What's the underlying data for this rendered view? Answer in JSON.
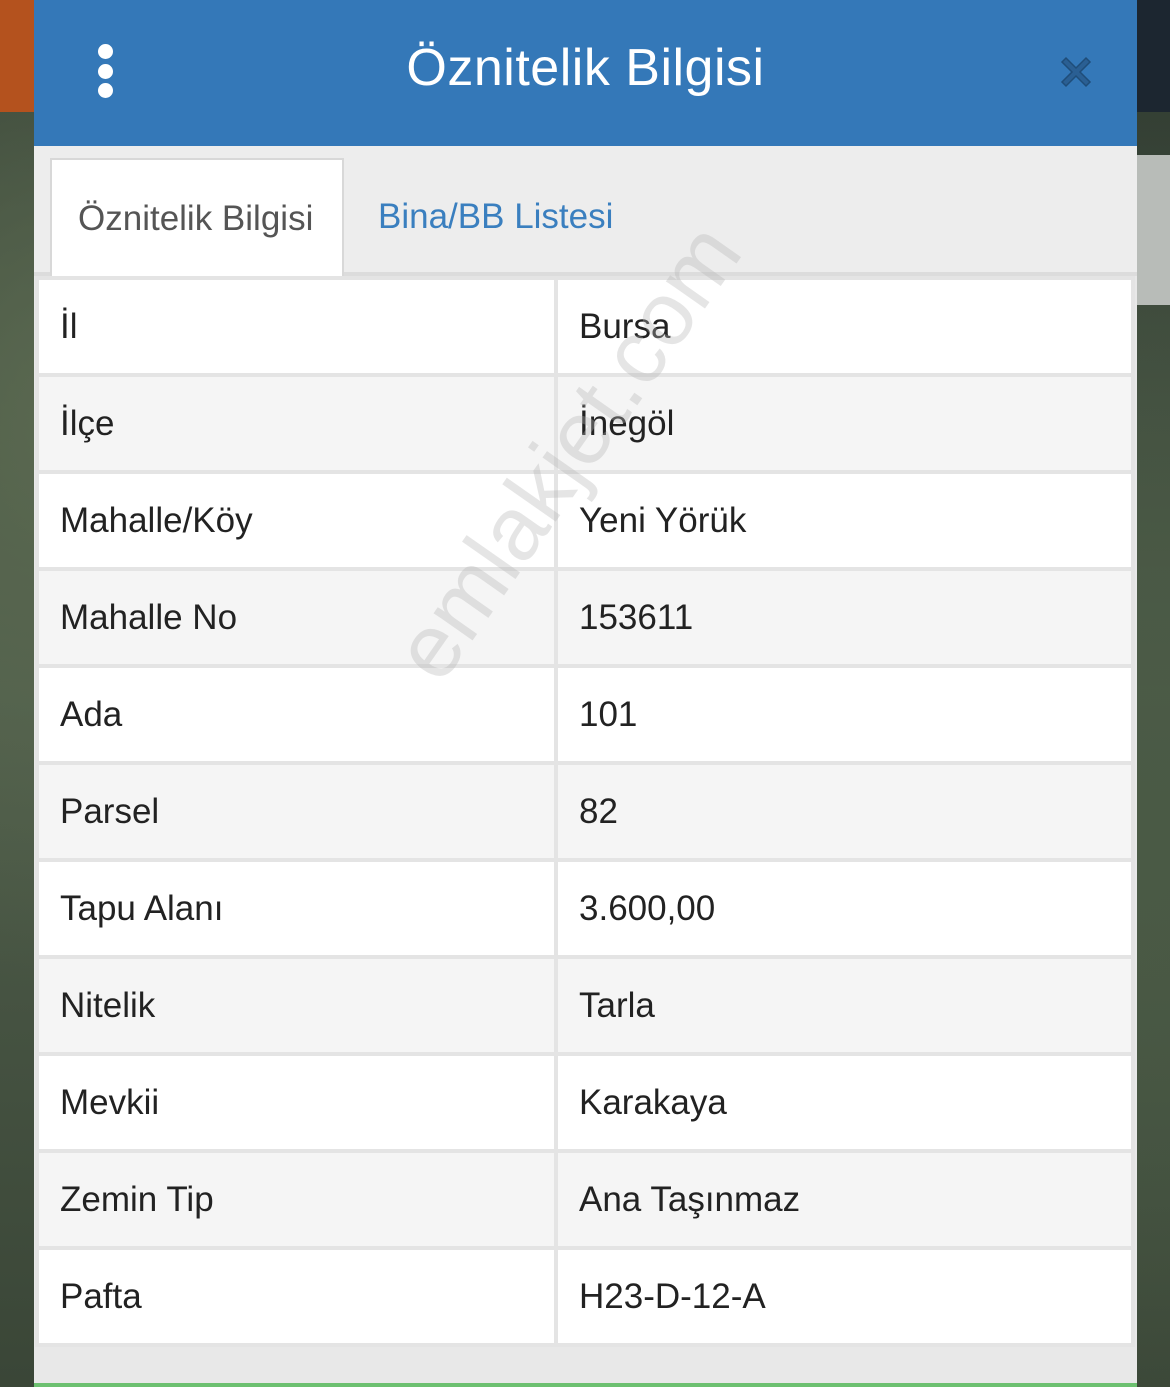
{
  "header": {
    "title": "Öznitelik Bilgisi"
  },
  "tabs": [
    {
      "label": "Öznitelik Bilgisi",
      "active": true
    },
    {
      "label": "Bina/BB Listesi",
      "active": false
    }
  ],
  "attributes": [
    {
      "key": "İl",
      "value": "Bursa"
    },
    {
      "key": "İlçe",
      "value": "İnegöl"
    },
    {
      "key": "Mahalle/Köy",
      "value": "Yeni Yörük"
    },
    {
      "key": "Mahalle No",
      "value": "153611"
    },
    {
      "key": "Ada",
      "value": "101"
    },
    {
      "key": "Parsel",
      "value": "82"
    },
    {
      "key": "Tapu Alanı",
      "value": "3.600,00"
    },
    {
      "key": "Nitelik",
      "value": "Tarla"
    },
    {
      "key": "Mevkii",
      "value": "Karakaya"
    },
    {
      "key": "Zemin Tip",
      "value": "Ana Taşınmaz"
    },
    {
      "key": "Pafta",
      "value": "H23-D-12-A"
    }
  ],
  "watermark": "emlakjet.com",
  "colors": {
    "header": "#3478b8",
    "tab_link": "#3a7fbf",
    "close_icon": "#2a5f93"
  },
  "icons": {
    "menu": "vertical-dots-icon",
    "close": "close-icon"
  }
}
